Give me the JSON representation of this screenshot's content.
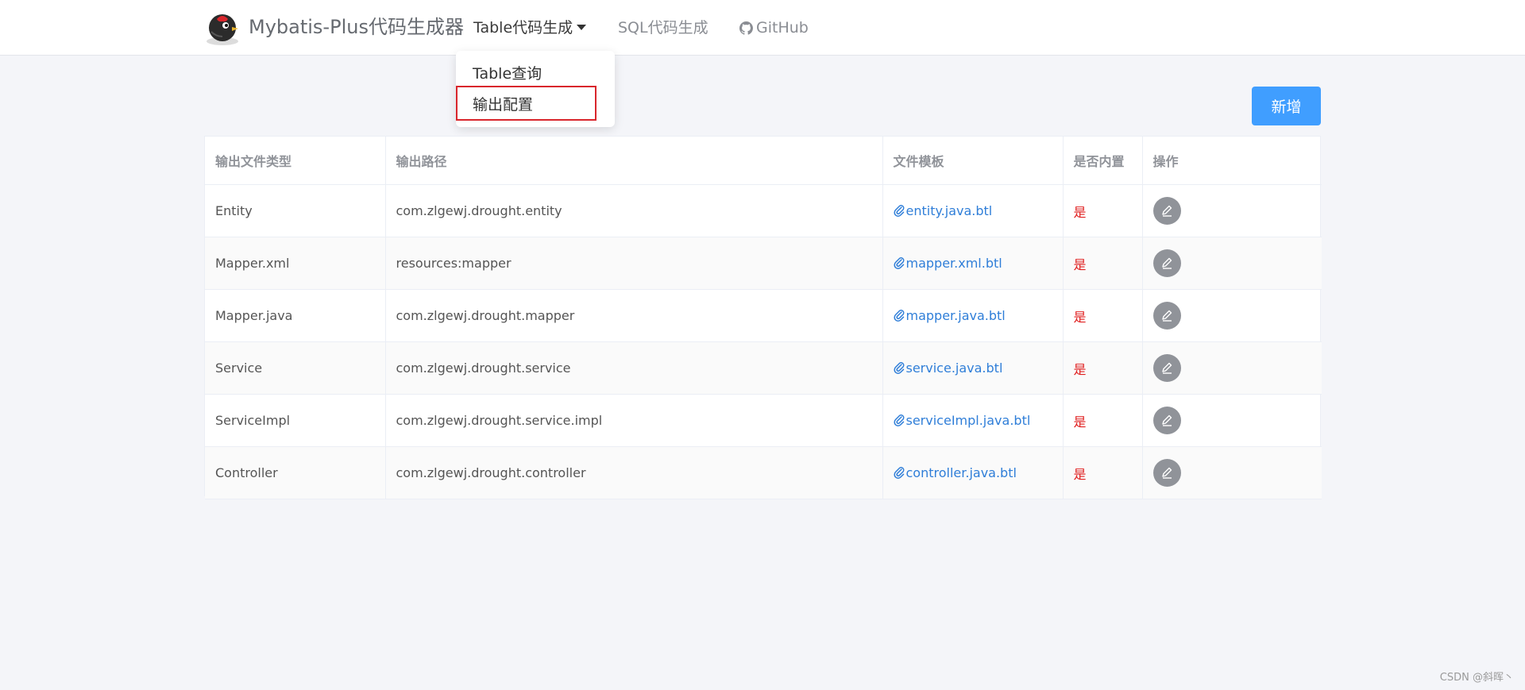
{
  "navbar": {
    "brand": "Mybatis-Plus代码生成器",
    "table_menu": "Table代码生成",
    "sql_menu": "SQL代码生成",
    "github": "GitHub"
  },
  "dropdown": {
    "items": [
      "Table查询",
      "输出配置"
    ],
    "highlighted": "输出配置"
  },
  "toolbar": {
    "add_label": "新增"
  },
  "table": {
    "headers": [
      "输出文件类型",
      "输出路径",
      "文件模板",
      "是否内置",
      "操作"
    ],
    "rows": [
      {
        "type": "Entity",
        "path": "com.zlgewj.drought.entity",
        "template": "entity.java.btl",
        "builtin": "是"
      },
      {
        "type": "Mapper.xml",
        "path": "resources:mapper",
        "template": "mapper.xml.btl",
        "builtin": "是"
      },
      {
        "type": "Mapper.java",
        "path": "com.zlgewj.drought.mapper",
        "template": "mapper.java.btl",
        "builtin": "是"
      },
      {
        "type": "Service",
        "path": "com.zlgewj.drought.service",
        "template": "service.java.btl",
        "builtin": "是"
      },
      {
        "type": "ServiceImpl",
        "path": "com.zlgewj.drought.service.impl",
        "template": "serviceImpl.java.btl",
        "builtin": "是"
      },
      {
        "type": "Controller",
        "path": "com.zlgewj.drought.controller",
        "template": "controller.java.btl",
        "builtin": "是"
      }
    ],
    "row_icons": {
      "template": "paperclip-icon",
      "action": "edit-icon"
    }
  },
  "colors": {
    "primary": "#409eff",
    "link": "#2f7ed8",
    "builtin": "#e02020",
    "highlight_border": "#d9262c",
    "background": "#f4f5f9"
  },
  "watermark": "CSDN @斜晖丶"
}
